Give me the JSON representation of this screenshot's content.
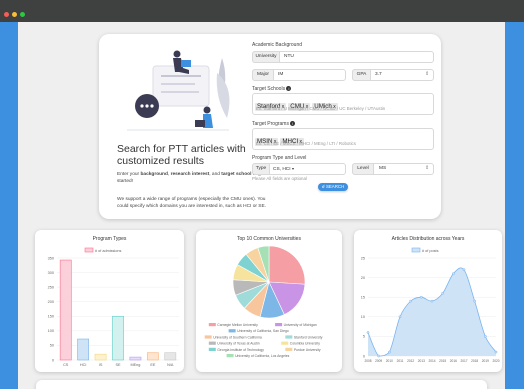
{
  "window": {
    "dots": [
      "#f25f57",
      "#f8bd3a",
      "#2dc840"
    ]
  },
  "hero": {
    "title": "Search for PTT articles with customized results",
    "desc1_prefix": "Enter your ",
    "desc1_b1": "background",
    "desc1_sep1": ", ",
    "desc1_b2": "research interest",
    "desc1_sep2": ", and ",
    "desc1_b3": "target school",
    "desc1_suffix": " to get started!",
    "desc2": "We support a wide range of programs (especially the CMU ones). You could specify which domains you are interested in, such as HCI or SE."
  },
  "form": {
    "academic_label": "Academic Background",
    "university_addon": "University",
    "university_value": "NTU",
    "major_addon": "Major",
    "major_value": "IM",
    "gpa_addon": "GPA",
    "gpa_value": "3.7",
    "schools_label": "Target Schools",
    "schools": [
      "Stanford",
      "CMU",
      "UMich"
    ],
    "schools_placeholder": "Ex: Stanford / U Michigan / CMU / UCSD / UC Berkeley / UTAustin",
    "programs_label": "Target Programs",
    "programs": [
      "MSIN",
      "MHCI"
    ],
    "programs_placeholder": "Ex: CS / EE / MSCS / MHCI / MEng / LTI / Robotics",
    "type_level_label": "Program Type and Level",
    "type_addon": "Type",
    "type_value": "CS, HCI",
    "level_addon": "Level",
    "level_value": "MS",
    "note": "Please All fields are optional",
    "search_label": "SEARCH",
    "chip_x": "x"
  },
  "colors": {
    "primary": "#3d8fe0",
    "bar_fills": [
      "#fbd0db",
      "#cfe3f7",
      "#fdf2d0",
      "#d3f1ef",
      "#e8dcfb",
      "#fde5cf",
      "#e6e6e6"
    ],
    "bar_strokes": [
      "#ff6f8f",
      "#7ab4ef",
      "#f6d67a",
      "#5fcfc7",
      "#b69cf2",
      "#fbb37a",
      "#c8c8c8"
    ],
    "pie": [
      "#f59ea4",
      "#c993e6",
      "#7db7e8",
      "#f8c69c",
      "#9fdbd8",
      "#b9b9b9",
      "#f6e49e",
      "#7ed3d2",
      "#f7d3a0",
      "#a6e1b5"
    ]
  },
  "chart_data": [
    {
      "type": "bar",
      "title": "Program Types",
      "legend": "# of admissions",
      "categories": [
        "CS",
        "HCI",
        "IS",
        "SE",
        "MEng",
        "EE",
        "N/A"
      ],
      "values": [
        343,
        72,
        20,
        150,
        10,
        25,
        25
      ],
      "ylim": [
        0,
        350
      ],
      "yticks": [
        0,
        50,
        100,
        150,
        200,
        250,
        300,
        350
      ],
      "grid": true
    },
    {
      "type": "pie",
      "title": "Top 10 Common Universities",
      "labels": [
        "Carnegie Mellon University",
        "University of Michigan",
        "University of California, San Diego",
        "University of Southern California",
        "Stanford University",
        "University of Texas at Austin",
        "Columbia University",
        "Georgia Institute of Technology",
        "Purdue University",
        "University of California, Los Angeles"
      ],
      "values": [
        26,
        17,
        11,
        8,
        7,
        7,
        7,
        6,
        6,
        5
      ],
      "legend_position": "bottom"
    },
    {
      "type": "area",
      "title": "Articles Distribution across Years",
      "legend": "# of posts",
      "x": [
        "2008",
        "2009",
        "2010",
        "2011",
        "2012",
        "2013",
        "2014",
        "2015",
        "2016",
        "2017",
        "2018",
        "2019",
        "2020"
      ],
      "values": [
        6,
        0,
        1,
        10,
        14,
        15,
        14,
        16,
        21,
        22,
        14,
        5,
        1
      ],
      "ylim": [
        0,
        25
      ],
      "yticks": [
        0,
        5,
        10,
        15,
        20,
        25
      ],
      "grid": true
    }
  ]
}
